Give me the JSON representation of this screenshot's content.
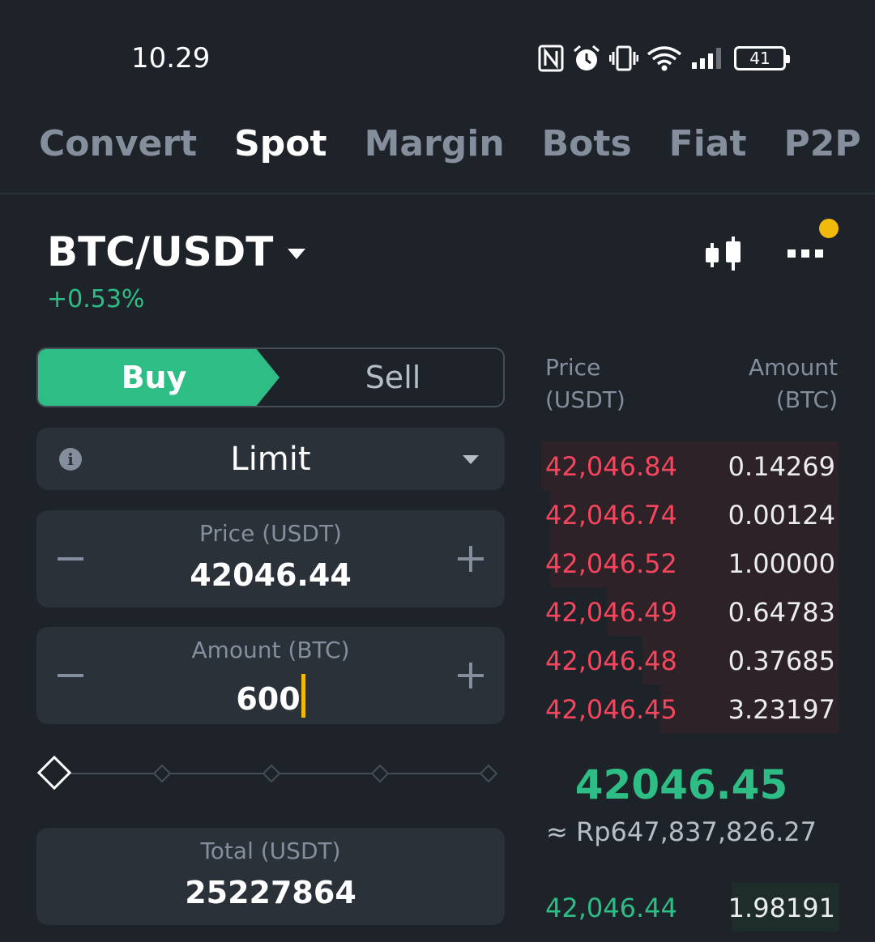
{
  "status_bar": {
    "time": "10.29",
    "battery": "41",
    "icons": [
      "nfc-icon",
      "alarm-icon",
      "vibrate-icon",
      "wifi-icon",
      "signal-icon",
      "battery-icon"
    ]
  },
  "tabs": [
    {
      "label": "Convert",
      "active": false
    },
    {
      "label": "Spot",
      "active": true
    },
    {
      "label": "Margin",
      "active": false
    },
    {
      "label": "Bots",
      "active": false
    },
    {
      "label": "Fiat",
      "active": false
    },
    {
      "label": "P2P",
      "active": false
    }
  ],
  "pair": {
    "name": "BTC/USDT",
    "change": "+0.53%"
  },
  "trade": {
    "buy_label": "Buy",
    "sell_label": "Sell",
    "order_type": "Limit",
    "price_label": "Price (USDT)",
    "price_value": "42046.44",
    "amount_label": "Amount (BTC)",
    "amount_value": "600",
    "total_label": "Total (USDT)",
    "total_value": "25227864",
    "slider_percent": 0
  },
  "order_book": {
    "price_header": [
      "Price",
      "(USDT)"
    ],
    "amount_header": [
      "Amount",
      "(BTC)"
    ],
    "asks": [
      {
        "price": "42,046.84",
        "amount": "0.14269",
        "depth": 1.0
      },
      {
        "price": "42,046.74",
        "amount": "0.00124",
        "depth": 0.97
      },
      {
        "price": "42,046.52",
        "amount": "1.00000",
        "depth": 0.97
      },
      {
        "price": "42,046.49",
        "amount": "0.64783",
        "depth": 0.78
      },
      {
        "price": "42,046.48",
        "amount": "0.37685",
        "depth": 0.66
      },
      {
        "price": "42,046.45",
        "amount": "3.23197",
        "depth": 0.6
      }
    ],
    "last_price": "42046.45",
    "fiat_price": "≈ Rp647,837,826.27",
    "bids": [
      {
        "price": "42,046.44",
        "amount": "1.98191",
        "depth": 0.36
      }
    ]
  },
  "colors": {
    "background": "#1e2329",
    "buy_green": "#2ebd85",
    "sell_red": "#f6465d",
    "accent_yellow": "#f0b90b"
  }
}
